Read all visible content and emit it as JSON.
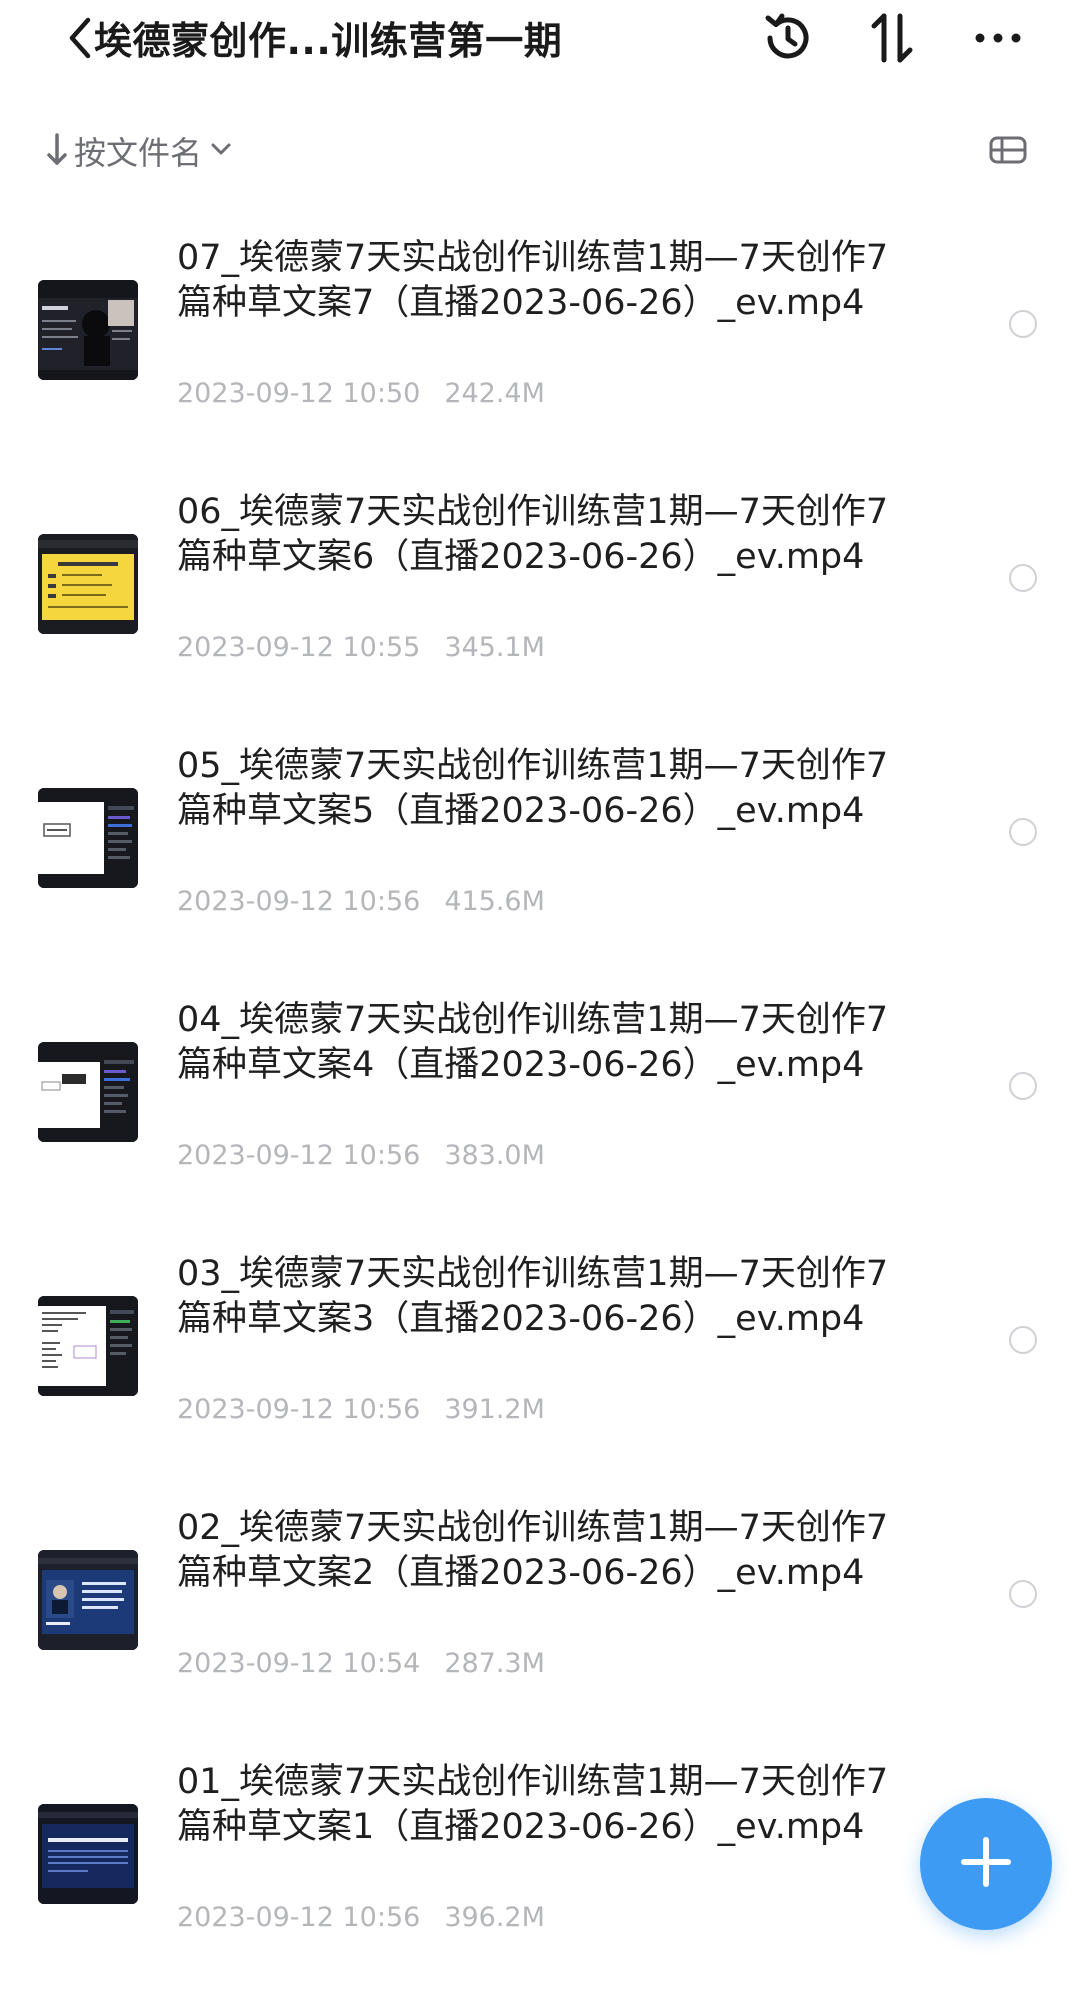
{
  "header": {
    "title": "埃德蒙创作...训练营第一期",
    "icons": [
      "back-icon",
      "history-icon",
      "sort-order-icon",
      "more-icon"
    ]
  },
  "sort": {
    "label": "按文件名",
    "icons": [
      "arrow-down-icon",
      "chevron-down-icon",
      "list-view-icon"
    ]
  },
  "files": [
    {
      "name": "07_埃德蒙7天实战创作训练营1期—7天创作7篇种草文案7（直播2023-06-26）_ev.mp4",
      "date": "2023-09-12 10:50",
      "size": "242.4M",
      "thumb": "speaker"
    },
    {
      "name": "06_埃德蒙7天实战创作训练营1期—7天创作7篇种草文案6（直播2023-06-26）_ev.mp4",
      "date": "2023-09-12 10:55",
      "size": "345.1M",
      "thumb": "yellow-slide"
    },
    {
      "name": "05_埃德蒙7天实战创作训练营1期—7天创作7篇种草文案5（直播2023-06-26）_ev.mp4",
      "date": "2023-09-12 10:56",
      "size": "415.6M",
      "thumb": "white-doc"
    },
    {
      "name": "04_埃德蒙7天实战创作训练营1期—7天创作7篇种草文案4（直播2023-06-26）_ev.mp4",
      "date": "2023-09-12 10:56",
      "size": "383.0M",
      "thumb": "white-doc"
    },
    {
      "name": "03_埃德蒙7天实战创作训练营1期—7天创作7篇种草文案3（直播2023-06-26）_ev.mp4",
      "date": "2023-09-12 10:56",
      "size": "391.2M",
      "thumb": "text-doc"
    },
    {
      "name": "02_埃德蒙7天实战创作训练营1期—7天创作7篇种草文案2（直播2023-06-26）_ev.mp4",
      "date": "2023-09-12 10:54",
      "size": "287.3M",
      "thumb": "blue-slide"
    },
    {
      "name": "01_埃德蒙7天实战创作训练营1期—7天创作7篇种草文案1（直播2023-06-26）_ev.mp4",
      "date": "2023-09-12 10:56",
      "size": "396.2M",
      "thumb": "dark-blue-slide"
    }
  ],
  "fab": {
    "icon": "plus-icon"
  },
  "colors": {
    "accent": "#3d9bf4",
    "meta_text": "#b4b6ba",
    "sort_text": "#6c6e73"
  }
}
